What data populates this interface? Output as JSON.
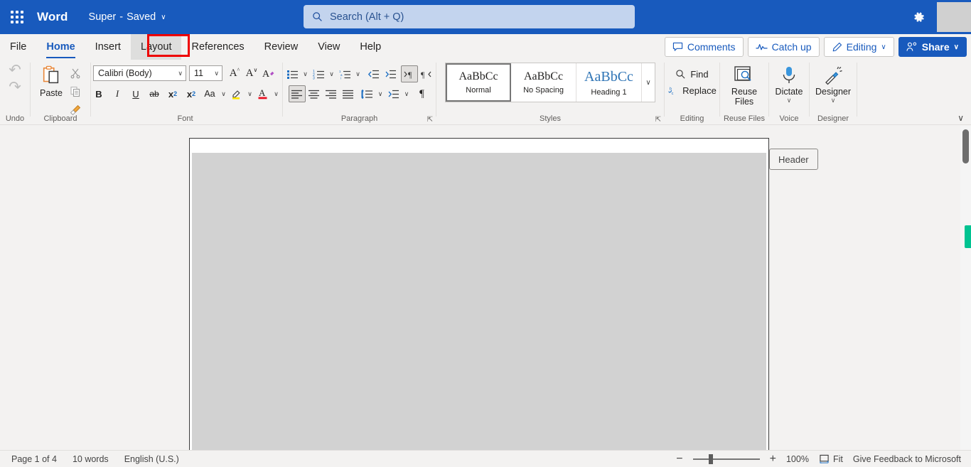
{
  "titlebar": {
    "app_launcher_icon": "waffle-grid-icon",
    "app_name": "Word",
    "document_name": "Super",
    "separator": "-",
    "save_state": "Saved",
    "chevron": "∨",
    "settings_icon": "gear-icon"
  },
  "search": {
    "icon": "search-icon",
    "placeholder": "Search (Alt + Q)"
  },
  "tabs": [
    {
      "label": "File",
      "state": "normal"
    },
    {
      "label": "Home",
      "state": "active"
    },
    {
      "label": "Insert",
      "state": "normal"
    },
    {
      "label": "Layout",
      "state": "hovered"
    },
    {
      "label": "References",
      "state": "normal"
    },
    {
      "label": "Review",
      "state": "normal"
    },
    {
      "label": "View",
      "state": "normal"
    },
    {
      "label": "Help",
      "state": "normal"
    }
  ],
  "highlight": {
    "target": "Layout",
    "color": "#ee0000"
  },
  "tab_actions": {
    "comments": {
      "label": "Comments",
      "icon": "comment-bubble-icon"
    },
    "catch_up": {
      "label": "Catch up",
      "icon": "activity-line-icon"
    },
    "editing": {
      "label": "Editing",
      "icon": "pencil-icon",
      "chevron": "∨"
    },
    "share": {
      "label": "Share",
      "icon": "share-person-icon",
      "chevron": "∨"
    }
  },
  "ribbon": {
    "undo": {
      "group_label": "Undo",
      "undo_icon": "undo-arrow-icon",
      "redo_icon": "redo-arrow-icon"
    },
    "clipboard": {
      "group_label": "Clipboard",
      "paste_label": "Paste",
      "paste_icon": "clipboard-paste-icon",
      "cut_icon": "scissors-icon",
      "copy_icon": "copy-pages-icon",
      "format_painter_icon": "format-painter-brush-icon"
    },
    "font": {
      "group_label": "Font",
      "font_name": "Calibri (Body)",
      "font_size": "11",
      "chevron": "∨",
      "grow_font_icon": "grow-font-icon",
      "shrink_font_icon": "shrink-font-icon",
      "clear_format_icon": "clear-formatting-icon",
      "bold": "B",
      "italic": "I",
      "underline": "U",
      "strikethrough": "ab",
      "subscript": "x",
      "subscript_sub": "2",
      "superscript": "x",
      "superscript_sup": "2",
      "change_case": "Aa",
      "highlight_icon": "text-highlight-icon",
      "font_color_icon": "font-color-icon",
      "highlight_color": "#ffe600",
      "font_color": "#e81123"
    },
    "paragraph": {
      "group_label": "Paragraph",
      "bullets_icon": "bullet-list-icon",
      "numbering_icon": "numbered-list-icon",
      "multilevel_icon": "multilevel-list-icon",
      "decrease_indent_icon": "decrease-indent-icon",
      "increase_indent_icon": "increase-indent-icon",
      "ltr_icon": "left-to-right-icon",
      "rtl_icon": "right-to-left-icon",
      "align_left_icon": "align-left-icon",
      "align_center_icon": "align-center-icon",
      "align_right_icon": "align-right-icon",
      "justify_icon": "justify-icon",
      "line_spacing_icon": "line-spacing-icon",
      "paragraph_spacing_icon": "paragraph-spacing-icon",
      "show_marks_icon": "pilcrow-icon",
      "dialog_launcher_icon": "dialog-launcher-icon",
      "chevron": "∨"
    },
    "styles": {
      "group_label": "Styles",
      "dialog_launcher_icon": "dialog-launcher-icon",
      "more_chevron": "∨",
      "items": [
        {
          "preview": "AaBbCc",
          "name": "Normal",
          "selected": true
        },
        {
          "preview": "AaBbCc",
          "name": "No Spacing",
          "selected": false
        },
        {
          "preview": "AaBbCc",
          "name": "Heading 1",
          "selected": false
        }
      ]
    },
    "editing": {
      "group_label": "Editing",
      "find_label": "Find",
      "find_icon": "search-icon",
      "replace_label": "Replace",
      "replace_icon": "replace-bc-icon"
    },
    "reuse_files": {
      "group_label": "Reuse Files",
      "button_label_line1": "Reuse",
      "button_label_line2": "Files",
      "icon": "reuse-files-icon"
    },
    "voice": {
      "group_label": "Voice",
      "button_label": "Dictate",
      "icon": "microphone-icon",
      "chevron": "∨"
    },
    "designer": {
      "group_label": "Designer",
      "button_label": "Designer",
      "icon": "magic-wand-icon",
      "chevron": "∨"
    },
    "collapse_ribbon_icon": "chevron-down-icon",
    "collapse_chevron": "∨"
  },
  "canvas": {
    "header_tag_label": "Header",
    "page_bottom_mark": "▾▴",
    "scrollbar": {
      "thumb": "scroll-thumb",
      "marker_color": "#00c391"
    }
  },
  "statusbar": {
    "page_indicator": "Page 1 of 4",
    "word_count": "10 words",
    "language": "English (U.S.)",
    "zoom_out_icon": "minus-icon",
    "zoom_in_icon": "plus-icon",
    "zoom_level": "100%",
    "fit_label": "Fit",
    "fit_icon": "fit-page-icon",
    "feedback_label": "Give Feedback to Microsoft"
  }
}
